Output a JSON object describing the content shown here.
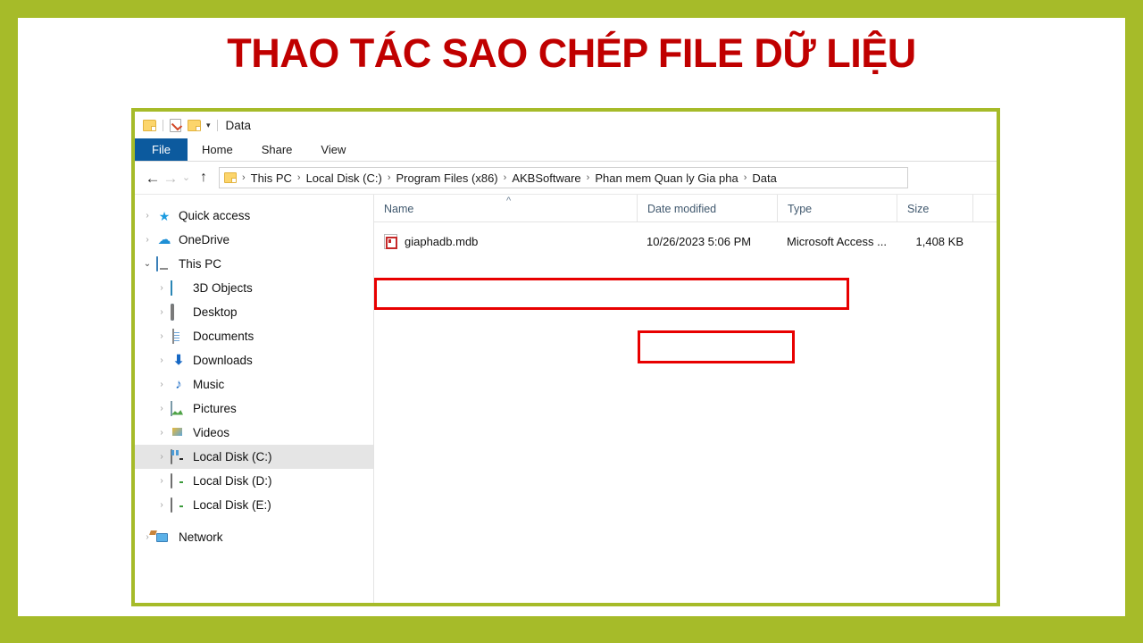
{
  "slide": {
    "title": "THAO TÁC SAO CHÉP FILE DỮ LIỆU",
    "border_color": "#A6BB29",
    "title_color": "#C00000",
    "background_color": "#FFFFFF"
  },
  "annotations": {
    "highlight_color": "#E80000",
    "address_bar_box": "red-rectangle-around-breadcrumb",
    "file_box": "red-rectangle-around-giaphadb-file"
  },
  "explorer": {
    "titlebar": {
      "window_title": "Data",
      "quick_access": [
        {
          "icon": "folder-icon",
          "label": ""
        },
        {
          "icon": "properties-checkbox-icon",
          "label": ""
        },
        {
          "icon": "new-folder-icon",
          "label": ""
        },
        {
          "icon": "chevron-down-icon",
          "label": ""
        }
      ]
    },
    "ribbon": {
      "tabs": [
        {
          "label": "File",
          "active": true
        },
        {
          "label": "Home",
          "active": false
        },
        {
          "label": "Share",
          "active": false
        },
        {
          "label": "View",
          "active": false
        }
      ],
      "file_tab_color": "#0C5A9E"
    },
    "navigation": {
      "back_icon": "arrow-left-icon",
      "forward_icon": "arrow-right-icon",
      "recent_icon": "chevron-down-icon",
      "up_icon": "arrow-up-icon",
      "breadcrumb": [
        "This PC",
        "Local Disk (C:)",
        "Program Files (x86)",
        "AKBSoftware",
        "Phan mem Quan ly Gia pha",
        "Data"
      ],
      "separator": "›"
    },
    "sidebar": {
      "items": [
        {
          "label": "Quick access",
          "icon": "star-icon",
          "indent": 0,
          "expander": "collapsed",
          "selected": false
        },
        {
          "label": "OneDrive",
          "icon": "cloud-icon",
          "indent": 0,
          "expander": "collapsed",
          "selected": false
        },
        {
          "label": "This PC",
          "icon": "computer-icon",
          "indent": 0,
          "expander": "expanded",
          "selected": false
        },
        {
          "label": "3D Objects",
          "icon": "cube-icon",
          "indent": 1,
          "expander": "collapsed",
          "selected": false
        },
        {
          "label": "Desktop",
          "icon": "desktop-icon",
          "indent": 1,
          "expander": "collapsed",
          "selected": false
        },
        {
          "label": "Documents",
          "icon": "document-icon",
          "indent": 1,
          "expander": "collapsed",
          "selected": false
        },
        {
          "label": "Downloads",
          "icon": "download-icon",
          "indent": 1,
          "expander": "collapsed",
          "selected": false
        },
        {
          "label": "Music",
          "icon": "music-note-icon",
          "indent": 1,
          "expander": "collapsed",
          "selected": false
        },
        {
          "label": "Pictures",
          "icon": "picture-icon",
          "indent": 1,
          "expander": "collapsed",
          "selected": false
        },
        {
          "label": "Videos",
          "icon": "video-icon",
          "indent": 1,
          "expander": "collapsed",
          "selected": false
        },
        {
          "label": "Local Disk (C:)",
          "icon": "hard-drive-system-icon",
          "indent": 1,
          "expander": "collapsed",
          "selected": true
        },
        {
          "label": "Local Disk (D:)",
          "icon": "hard-drive-icon",
          "indent": 1,
          "expander": "collapsed",
          "selected": false
        },
        {
          "label": "Local Disk (E:)",
          "icon": "hard-drive-icon",
          "indent": 1,
          "expander": "collapsed",
          "selected": false
        },
        {
          "label": "Network",
          "icon": "network-icon",
          "indent": 0,
          "expander": "collapsed",
          "selected": false
        }
      ]
    },
    "file_list": {
      "columns": [
        {
          "key": "name",
          "label": "Name",
          "sorted": "ascending",
          "sort_icon": "caret-up-icon"
        },
        {
          "key": "date",
          "label": "Date modified",
          "sorted": "none"
        },
        {
          "key": "type",
          "label": "Type",
          "sorted": "none"
        },
        {
          "key": "size",
          "label": "Size",
          "sorted": "none"
        }
      ],
      "rows": [
        {
          "name": "giaphadb.mdb",
          "icon": "access-database-icon",
          "date": "10/26/2023 5:06 PM",
          "type": "Microsoft Access ...",
          "size": "1,408 KB",
          "highlighted": true
        }
      ]
    }
  }
}
